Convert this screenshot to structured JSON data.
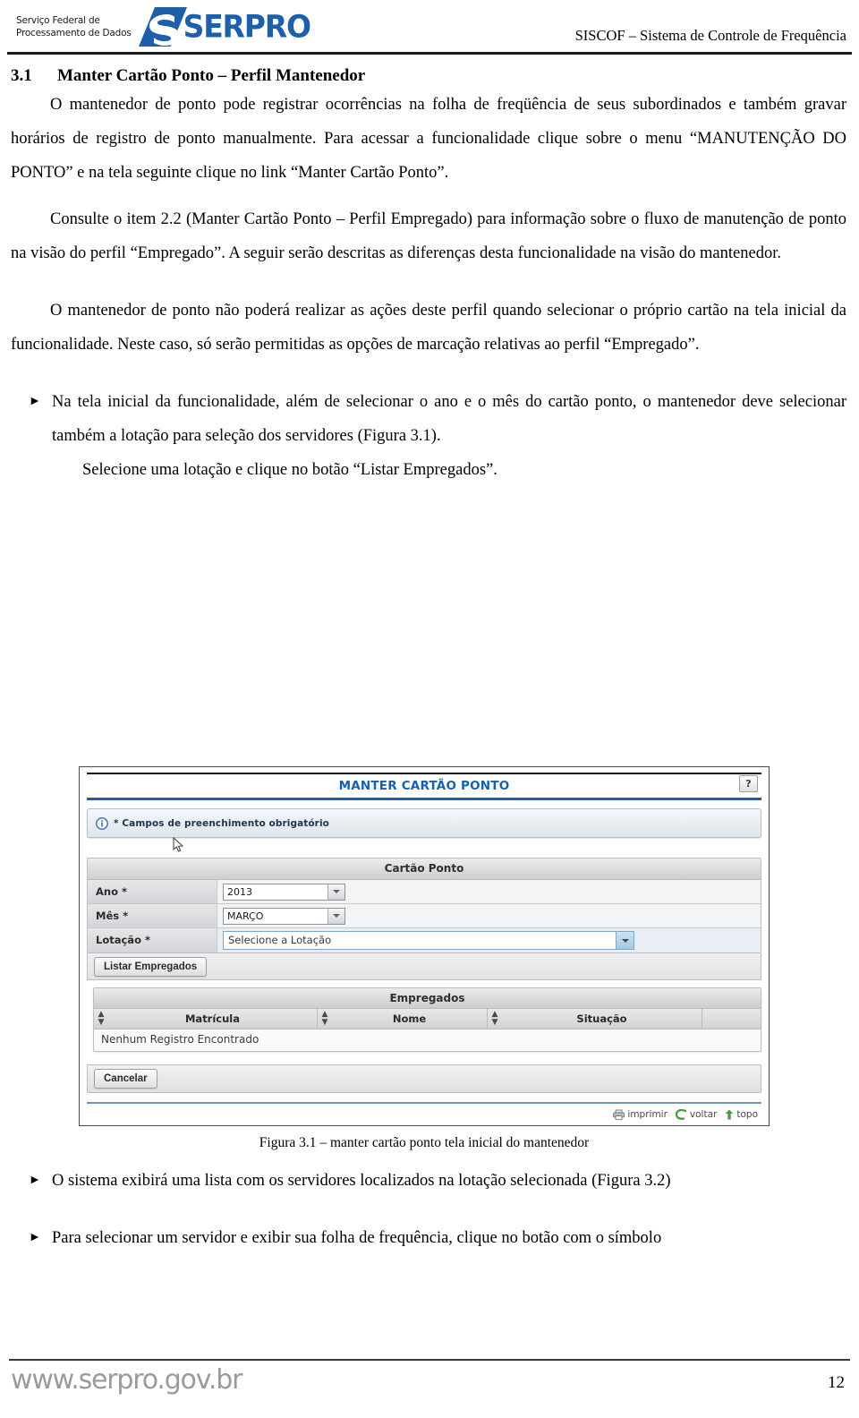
{
  "header": {
    "logo_line1": "Serviço Federal de",
    "logo_line2": "Processamento de Dados",
    "logo_word": "SERPRO",
    "system_title": "SISCOF – Sistema de Controle de Frequência"
  },
  "section": {
    "number": "3.1",
    "title": "Manter Cartão Ponto – Perfil Mantenedor"
  },
  "paragraphs": {
    "p1": "O mantenedor de ponto pode registrar ocorrências na folha de freqüência de seus subordinados e também gravar horários de registro de ponto manualmente. Para acessar a funcionalidade clique sobre o menu “MANUTENÇÃO DO PONTO” e na tela seguinte clique no link “Manter Cartão Ponto”.",
    "p2": "Consulte o item 2.2 (Manter Cartão Ponto – Perfil Empregado) para informação sobre o fluxo de manutenção de ponto na visão do perfil “Empregado”. A seguir serão descritas as diferenças desta funcionalidade na visão do mantenedor.",
    "p3": "O mantenedor de ponto não poderá realizar as ações deste perfil quando selecionar o próprio cartão na tela inicial da funcionalidade. Neste caso, só serão permitidas as opções de marcação relativas ao perfil “Empregado”."
  },
  "bullets": {
    "b1_main": "Na tela inicial da funcionalidade, além de selecionar o ano e o mês do cartão ponto, o mantenedor deve selecionar também a lotação para seleção dos servidores (Figura 3.1).",
    "b1_sub": "Selecione uma lotação e clique no botão “Listar Empregados”.",
    "b2": "O sistema exibirá uma lista com os servidores localizados na lotação selecionada (Figura 3.2)",
    "b3": "Para selecionar um servidor e exibir sua folha de frequência, clique no botão com o símbolo",
    "marker": "►"
  },
  "figure": {
    "caption": "Figura 3.1 – manter cartão ponto tela inicial do mantenedor",
    "screen": {
      "title": "MANTER CARTÃO PONTO",
      "help_label": "?",
      "info_message": "* Campos de preenchimento obrigatório",
      "panel_title": "Cartão Ponto",
      "fields": [
        {
          "label": "Ano *",
          "value": "2013",
          "type": "select-small"
        },
        {
          "label": "Mês *",
          "value": "MARÇO",
          "type": "select-small"
        },
        {
          "label": "Lotação *",
          "value": "Selecione a Lotação",
          "type": "select-wide"
        }
      ],
      "list_button": "Listar Empregados",
      "table": {
        "title": "Empregados",
        "columns": [
          "Matrícula",
          "Nome",
          "Situação",
          ""
        ],
        "empty_message": "Nenhum Registro Encontrado",
        "rows": []
      },
      "cancel_button": "Cancelar",
      "footer_links": [
        {
          "label": "imprimir",
          "icon": "printer-icon"
        },
        {
          "label": "voltar",
          "icon": "back-arrow-icon"
        },
        {
          "label": "topo",
          "icon": "up-arrow-icon"
        }
      ]
    }
  },
  "footer": {
    "site": "www.serpro.gov.br",
    "page_number": "12"
  },
  "colors": {
    "brand_blue": "#1d5fa8",
    "title_blue": "#1b5fad",
    "link_green": "#4a9a45",
    "footer_gray": "#9a9a9a"
  }
}
